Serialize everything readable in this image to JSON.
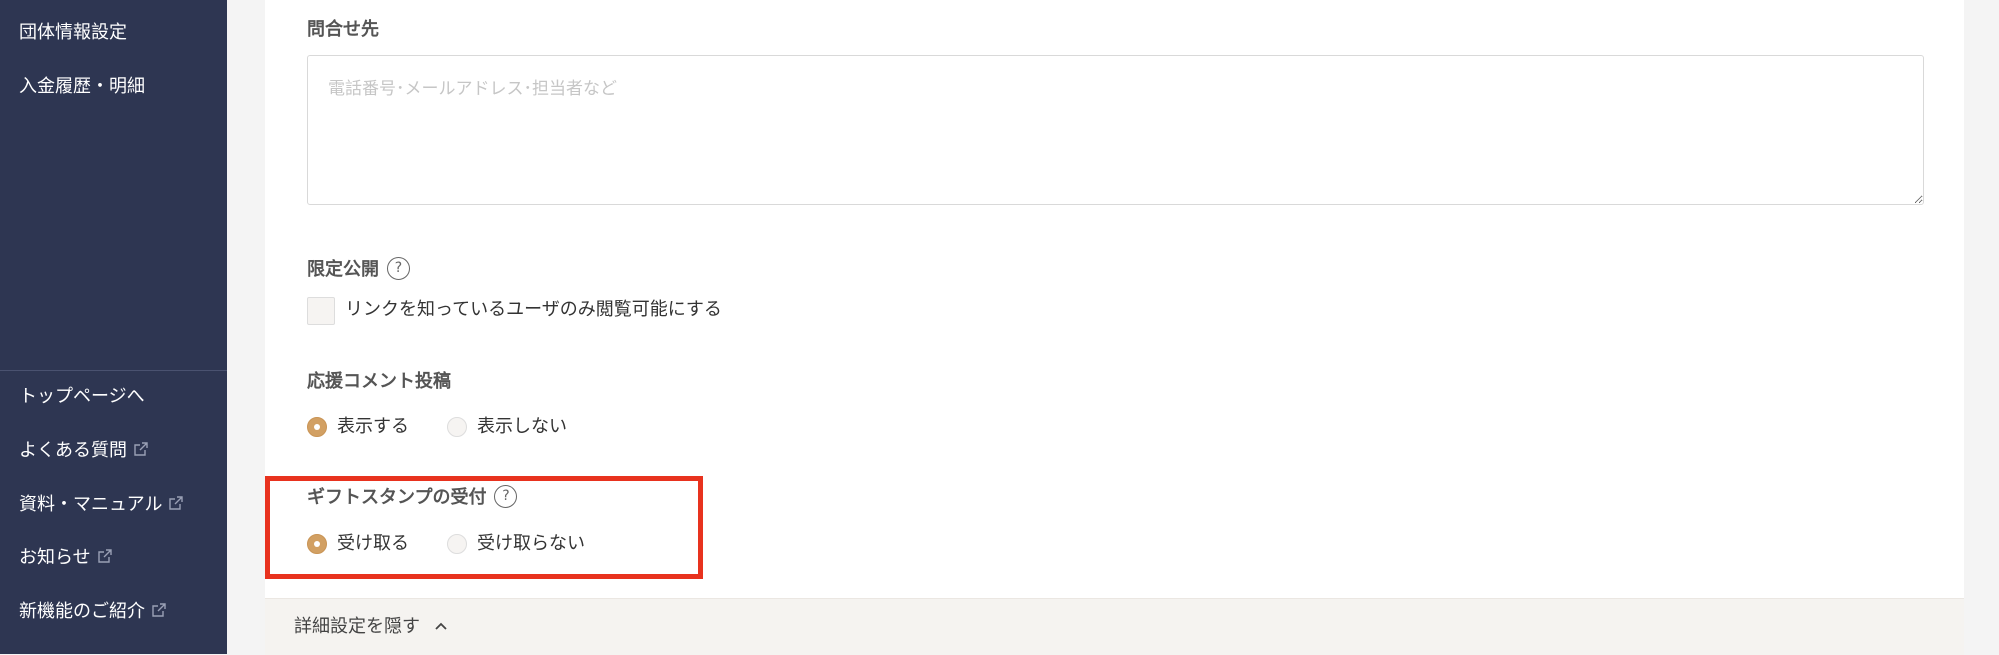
{
  "sidebar": {
    "top_items": [
      {
        "label": "団体情報設定"
      },
      {
        "label": "入金履歴・明細"
      }
    ],
    "bottom_items": [
      {
        "label": "トップページへ",
        "external": false
      },
      {
        "label": "よくある質問",
        "external": true
      },
      {
        "label": "資料・マニュアル",
        "external": true
      },
      {
        "label": "お知らせ",
        "external": true
      },
      {
        "label": "新機能のご紹介",
        "external": true
      }
    ]
  },
  "form": {
    "contact": {
      "label": "問合せ先",
      "placeholder": "電話番号･メールアドレス･担当者など",
      "value": ""
    },
    "limited": {
      "label": "限定公開",
      "help": "?",
      "checkbox_label": "リンクを知っているユーザのみ閲覧可能にする",
      "checked": false
    },
    "comment": {
      "label": "応援コメント投稿",
      "options": [
        "表示する",
        "表示しない"
      ],
      "selected": "表示する"
    },
    "gift": {
      "label": "ギフトスタンプの受付",
      "help": "?",
      "options": [
        "受け取る",
        "受け取らない"
      ],
      "selected": "受け取る"
    }
  },
  "footer": {
    "toggle_label": "詳細設定を隠す"
  },
  "colors": {
    "sidebar_bg": "#2e3652",
    "accent": "#d2a063",
    "highlight": "#e8321e"
  }
}
